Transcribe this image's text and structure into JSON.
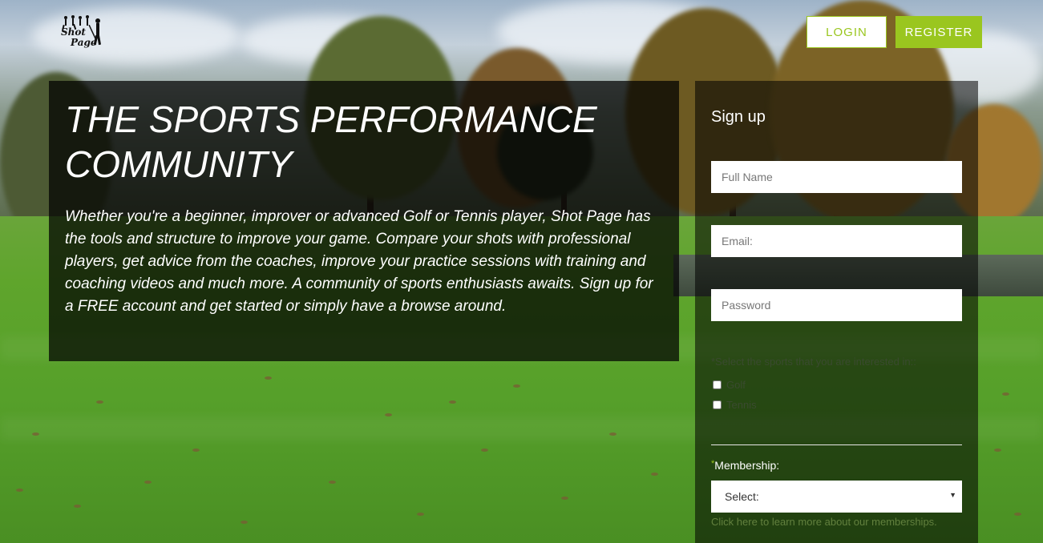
{
  "header": {
    "logo_text_line1": "Shot",
    "logo_text_line2": "Page",
    "login_label": "LOGIN",
    "register_label": "REGISTER"
  },
  "hero": {
    "title": "THE SPORTS PERFORMANCE COMMUNITY",
    "description": "Whether you're a beginner, improver or advanced Golf or Tennis player, Shot Page has the tools and structure to improve your game. Compare your shots with professional players, get advice from the coaches, improve your practice sessions with training and coaching videos and much more. A community of sports enthusiasts awaits. Sign up for a FREE account and get started or simply have a browse around."
  },
  "signup": {
    "title": "Sign up",
    "full_name_placeholder": "Full Name",
    "email_placeholder": "Email:",
    "password_placeholder": "Password",
    "sports_label": "*Select the sports that you are interested in::",
    "sports": [
      "Golf",
      "Tennis"
    ],
    "membership_required_mark": "*",
    "membership_label": "Membership:",
    "membership_selected": "Select:",
    "membership_link": "Click here to learn more about our memberships."
  },
  "colors": {
    "accent": "#9ac61f",
    "panel": "rgba(0,0,0,0.72)"
  },
  "icons": {
    "logo": "golfer-silhouettes-logo",
    "select_caret": "caret-down-icon"
  }
}
